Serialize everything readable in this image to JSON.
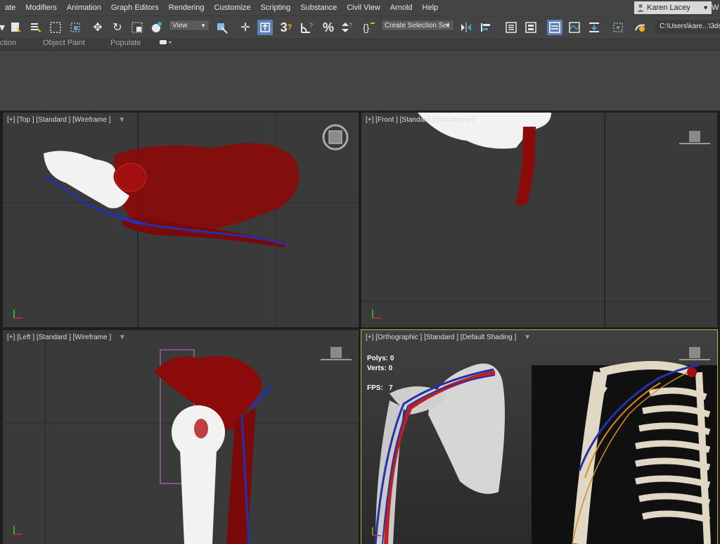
{
  "menu": {
    "items": [
      "ate",
      "Modifiers",
      "Animation",
      "Graph Editors",
      "Rendering",
      "Customize",
      "Scripting",
      "Substance",
      "Civil View",
      "Arnold",
      "Help"
    ],
    "user_name": "Karen Lacey",
    "trailing_text": "W"
  },
  "toolbar": {
    "view_dropdown": "View",
    "selection_set_dropdown": "Create Selection Set",
    "project_path": "C:\\Users\\kare...\\3ds"
  },
  "ribbon": {
    "tabs": [
      "ction",
      "Object Paint",
      "Populate"
    ]
  },
  "viewports": {
    "top": {
      "label": "[+] [Top ] [Standard ] [Wireframe ]"
    },
    "front": {
      "label": "[+] [Front ] [Standard ] [Wireframe ]"
    },
    "left": {
      "label": "[+] [Left ] [Standard ] [Wireframe ]"
    },
    "perspective": {
      "label": "[+] [Orthographic ] [Standard ] [Default Shading ]",
      "polys_label": "Polys:",
      "polys_value": "0",
      "verts_label": "Verts:",
      "verts_value": "0",
      "fps_label": "FPS:",
      "fps_value": "7"
    }
  },
  "colors": {
    "menubar": "#444444",
    "viewport_bg": "#3a3a3a",
    "active_viewport_border": "#c8b040",
    "accent_active": "#5a7fb6",
    "bone_white": "#ffffff",
    "muscle_red": "#8b0a0a",
    "nerve_blue": "#2233aa"
  }
}
